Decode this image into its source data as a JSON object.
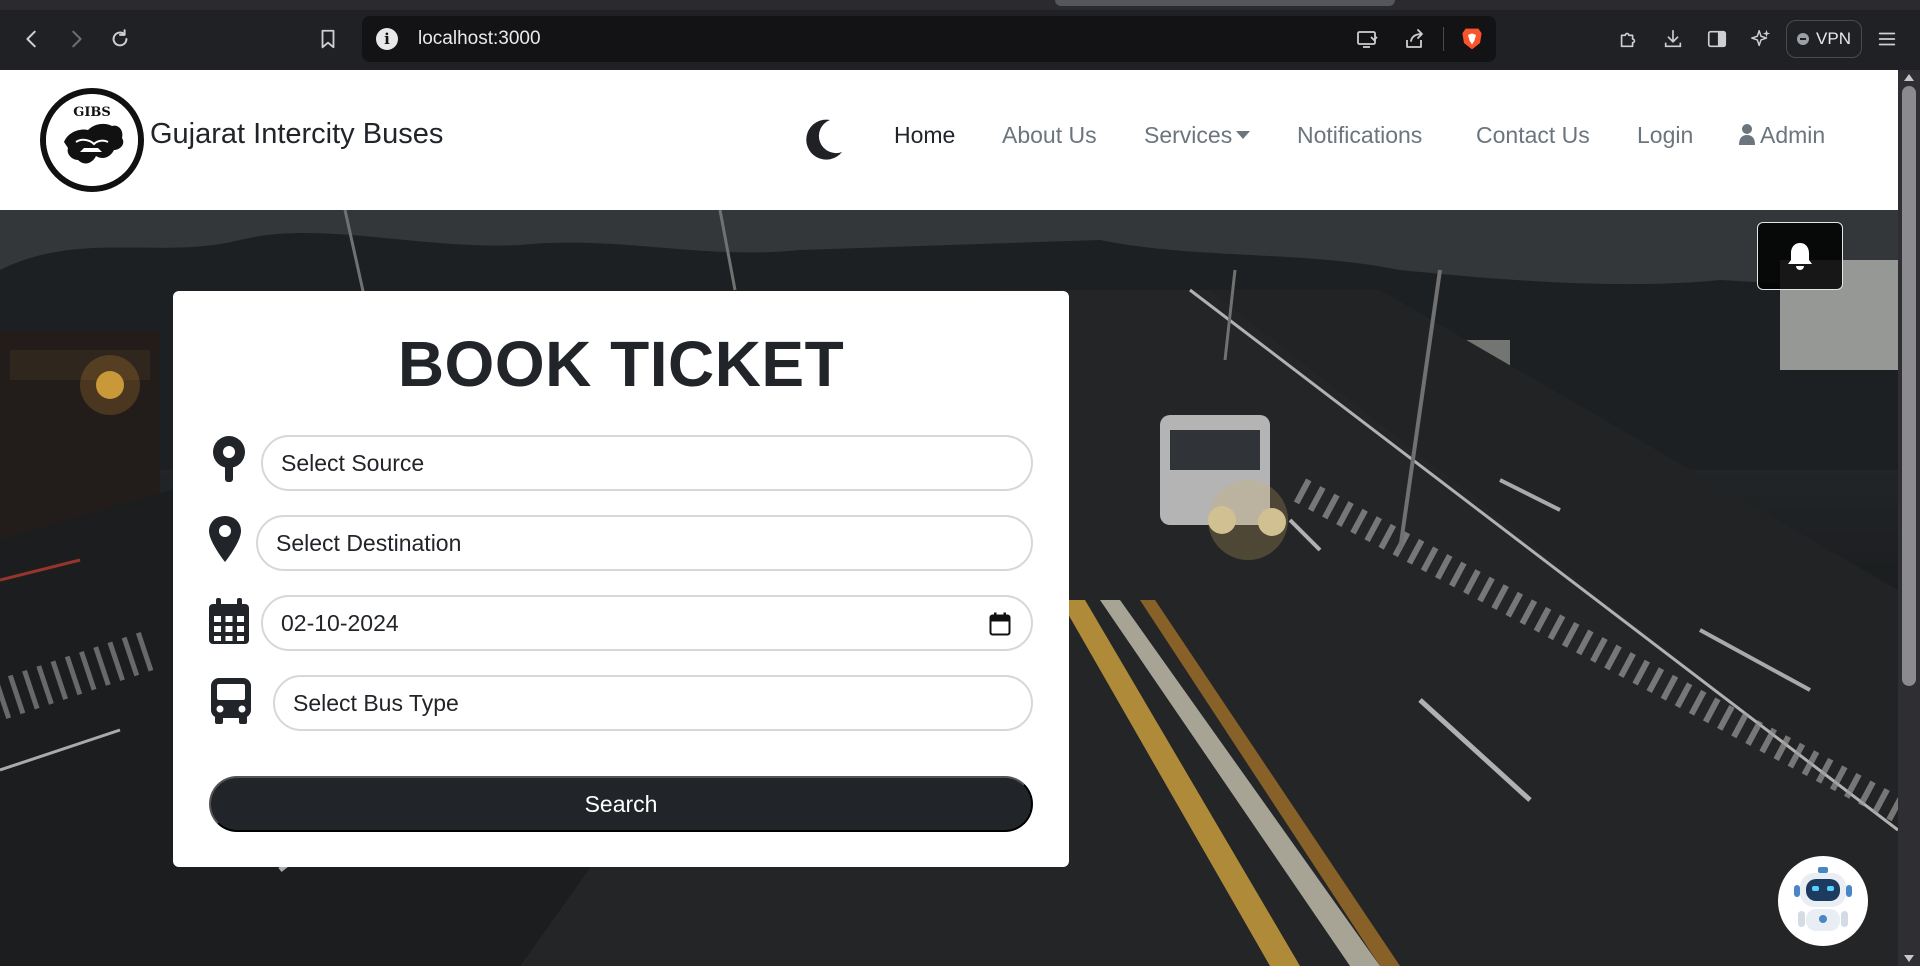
{
  "browser": {
    "url": "localhost:3000",
    "vpn_label": "VPN"
  },
  "navbar": {
    "brand": "Gujarat Intercity Buses",
    "logo_text": "GIBS",
    "items": [
      {
        "label": "Home",
        "active": true
      },
      {
        "label": "About Us"
      },
      {
        "label": "Services",
        "dropdown": true
      },
      {
        "label": "Notifications"
      },
      {
        "label": "Contact Us"
      },
      {
        "label": "Login"
      },
      {
        "label": "Admin",
        "icon": "user-icon"
      }
    ],
    "theme_toggle_icon": "moon-icon"
  },
  "booking": {
    "title": "BOOK TICKET",
    "source_placeholder": "Select Source",
    "destination_placeholder": "Select Destination",
    "date_value": "02-10-2024",
    "bus_type_placeholder": "Select Bus Type",
    "search_label": "Search"
  },
  "floating": {
    "notification_icon": "bell-icon",
    "chatbot_icon": "robot-icon"
  },
  "colors": {
    "primary_dark": "#212529",
    "muted_text": "#6c757d",
    "border": "#d5d8db"
  }
}
